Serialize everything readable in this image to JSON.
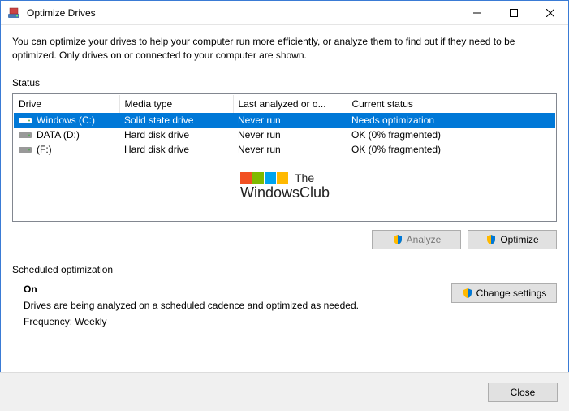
{
  "window": {
    "title": "Optimize Drives"
  },
  "intro": "You can optimize your drives to help your computer run more efficiently, or analyze them to find out if they need to be optimized. Only drives on or connected to your computer are shown.",
  "status_label": "Status",
  "columns": {
    "drive": "Drive",
    "media": "Media type",
    "last": "Last analyzed or o...",
    "current": "Current status"
  },
  "drives": [
    {
      "name": "Windows (C:)",
      "media": "Solid state drive",
      "last": "Never run",
      "status": "Needs optimization",
      "selected": true
    },
    {
      "name": "DATA (D:)",
      "media": "Hard disk drive",
      "last": "Never run",
      "status": "OK (0% fragmented)",
      "selected": false
    },
    {
      "name": "(F:)",
      "media": "Hard disk drive",
      "last": "Never run",
      "status": "OK (0% fragmented)",
      "selected": false
    }
  ],
  "buttons": {
    "analyze": "Analyze",
    "optimize": "Optimize",
    "change_settings": "Change settings",
    "close": "Close"
  },
  "scheduled": {
    "label": "Scheduled optimization",
    "state": "On",
    "desc": "Drives are being analyzed on a scheduled cadence and optimized as needed.",
    "freq": "Frequency: Weekly"
  },
  "watermark": {
    "line1": "The",
    "line2": "WindowsClub"
  }
}
